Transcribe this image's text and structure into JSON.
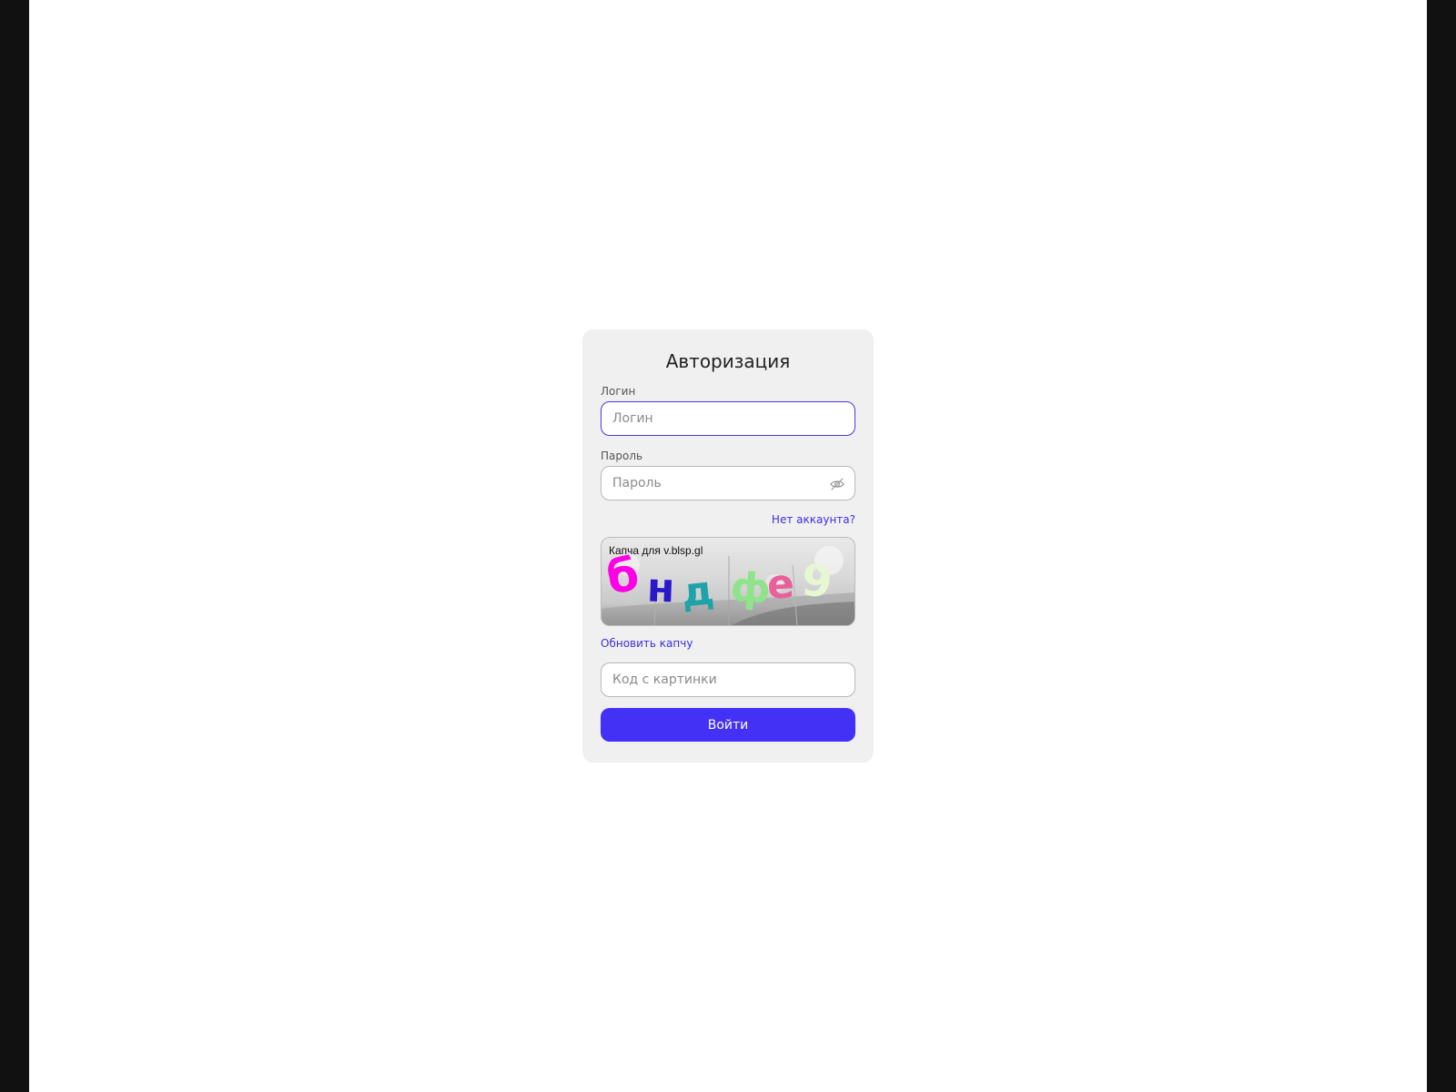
{
  "auth": {
    "title": "Авторизация",
    "login_label": "Логин",
    "login_placeholder": "Логин",
    "login_value": "",
    "password_label": "Пароль",
    "password_placeholder": "Пароль",
    "password_value": "",
    "password_toggle_icon": "eye-off-icon",
    "register_link": "Нет аккаунта?",
    "captcha": {
      "caption": "Капча для v.blsp.gl",
      "glyphs": [
        "б",
        "н",
        "д",
        "ф",
        "е",
        "9"
      ],
      "glyph_colors": [
        "#ff00e6",
        "#2a17c9",
        "#1ea3a8",
        "#8fe38a",
        "#e8609a",
        "#e6f7d2"
      ]
    },
    "refresh_captcha_link": "Обновить капчу",
    "code_placeholder": "Код с картинки",
    "code_value": "",
    "submit_label": "Войти",
    "colors": {
      "accent": "#4331f5",
      "link": "#3d2ee0",
      "card_bg": "#f0f0f0"
    }
  }
}
